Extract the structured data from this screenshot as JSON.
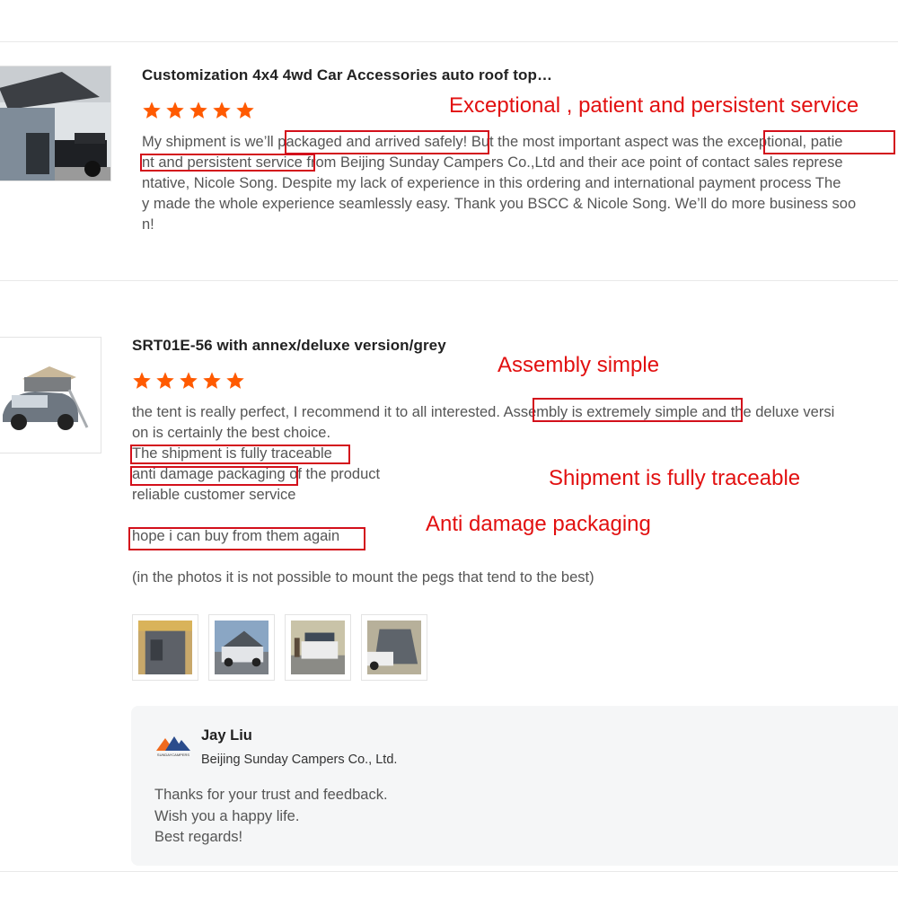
{
  "colors": {
    "accent_orange": "#ff5a00",
    "annotation_red": "#e21010",
    "box_red": "#d3101b"
  },
  "reviews": [
    {
      "product_title": "Customization 4x4 4wd Car Accessories auto roof top…",
      "rating": 5,
      "text_lines": [
        "My shipment is we’ll packaged and arrived safely! But the most important aspect was the exceptional, patie",
        "nt and persistent service from Beijing Sunday Campers Co.,Ltd and their ace point of contact sales represe",
        "ntative, Nicole Song. Despite my lack of experience in this ordering and international payment process The",
        "y made the whole experience seamlessly easy. Thank you BSCC & Nicole Song. We’ll do more business soo",
        "n!"
      ],
      "annotation": "Exceptional , patient and persistent service",
      "thumbnail_icon": "roof-tent-annex-photo"
    },
    {
      "product_title": "SRT01E-56 with annex/deluxe version/grey",
      "rating": 5,
      "text_lines": [
        "the tent is really perfect, I recommend it to all interested. Assembly is extremely simple and the deluxe versi",
        "on is certainly the best choice.",
        "The shipment is fully traceable",
        "anti damage packaging of the product",
        "reliable customer service",
        "",
        "hope i can buy from them again",
        "",
        "(in the photos it is not possible to mount the pegs that tend to the best)"
      ],
      "annotations": [
        "Assembly simple",
        "Shipment is fully traceable",
        "Anti damage packaging"
      ],
      "thumbnail_icon": "car-roof-tent-photo",
      "photos": [
        "photo-1",
        "photo-2",
        "photo-3",
        "photo-4"
      ]
    }
  ],
  "reply": {
    "name": "Jay Liu",
    "company": "Beijing Sunday Campers Co., Ltd.",
    "logo_text": "SUNDAYCAMPERS",
    "lines": [
      "Thanks for your trust and feedback.",
      "Wish you a happy life.",
      "Best regards!"
    ]
  }
}
